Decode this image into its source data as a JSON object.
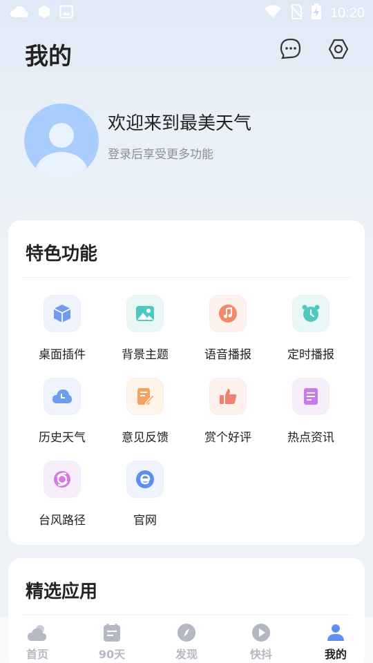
{
  "status_bar": {
    "time": "10:20"
  },
  "header": {
    "title": "我的"
  },
  "profile": {
    "welcome": "欢迎来到最美天气",
    "subtitle": "登录后享受更多功能"
  },
  "features": {
    "title": "特色功能",
    "items": [
      {
        "label": "桌面插件",
        "icon": "cube-icon",
        "color": "#6d9cf0"
      },
      {
        "label": "背景主题",
        "icon": "picture-icon",
        "color": "#4fc9c0"
      },
      {
        "label": "语音播报",
        "icon": "music-icon",
        "color": "#f08a6a"
      },
      {
        "label": "定时播报",
        "icon": "alarm-clock-icon",
        "color": "#4fc9c0"
      },
      {
        "label": "历史天气",
        "icon": "history-cloud-icon",
        "color": "#6d9cf0"
      },
      {
        "label": "意见反馈",
        "icon": "feedback-edit-icon",
        "color": "#f4a25e"
      },
      {
        "label": "赏个好评",
        "icon": "thumbs-up-icon",
        "color": "#f08070"
      },
      {
        "label": "热点资讯",
        "icon": "news-icon",
        "color": "#c77be6"
      },
      {
        "label": "台风路径",
        "icon": "typhoon-icon",
        "color": "#d67ae0"
      },
      {
        "label": "官网",
        "icon": "website-e-icon",
        "color": "#5f8ef0"
      }
    ]
  },
  "apps": {
    "title": "精选应用"
  },
  "bottom_nav": {
    "items": [
      {
        "label": "首页",
        "icon": "weather-cloud-icon"
      },
      {
        "label": "90天",
        "icon": "calendar-icon"
      },
      {
        "label": "发现",
        "icon": "compass-icon"
      },
      {
        "label": "快抖",
        "icon": "play-icon"
      },
      {
        "label": "我的",
        "icon": "user-icon",
        "active": true
      }
    ]
  }
}
